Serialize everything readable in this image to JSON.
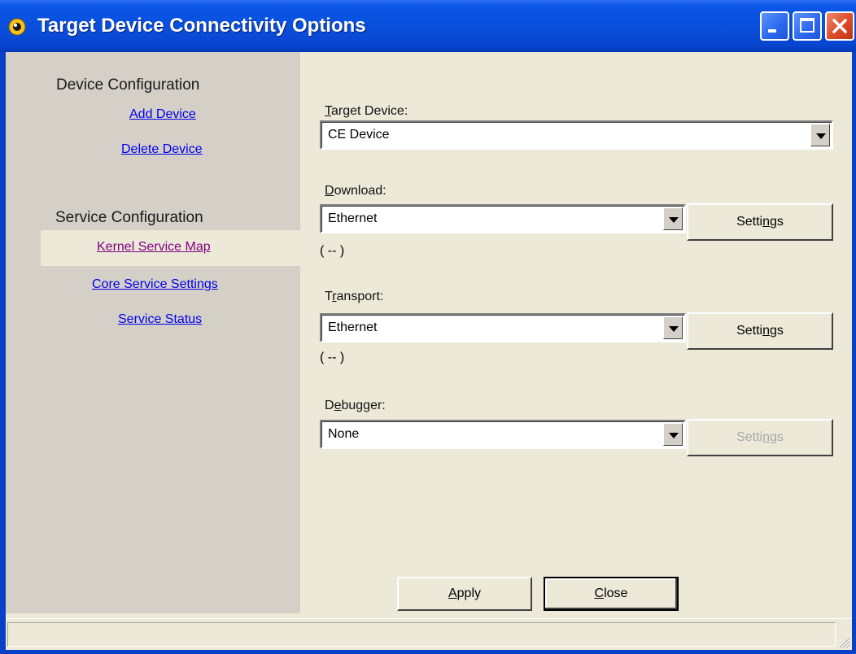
{
  "window": {
    "title": "Target Device Connectivity Options",
    "controls": [
      "minimize-icon",
      "maximize-icon",
      "close-icon"
    ]
  },
  "sidebar": {
    "device_configuration": {
      "heading": "Device Configuration",
      "links": [
        "Add Device",
        "Delete Device"
      ]
    },
    "service_configuration": {
      "heading": "Service Configuration",
      "links": [
        "Kernel Service Map",
        "Core Service Settings",
        "Service Status"
      ],
      "selected": "Kernel Service Map"
    }
  },
  "form": {
    "target_device": {
      "label_mnemonic": "T",
      "label_rest": "arget Device:",
      "value": "CE Device"
    },
    "download": {
      "label_mnemonic": "D",
      "label_rest": "ownload:",
      "value": "Ethernet",
      "status": "( -- )",
      "button_pre": "Setti",
      "button_mnemonic": "n",
      "button_post": "gs"
    },
    "transport": {
      "label_pre": "T",
      "label_mnemonic": "r",
      "label_rest": "ansport:",
      "value": "Ethernet",
      "status": "( -- )",
      "button_pre": "Setti",
      "button_mnemonic": "n",
      "button_post": "gs"
    },
    "debugger": {
      "label_pre": "D",
      "label_mnemonic": "e",
      "label_rest": "bugger:",
      "value": "None",
      "button_pre": "Setti",
      "button_mnemonic": "n",
      "button_post": "gs",
      "button_disabled": true
    }
  },
  "footer": {
    "apply_mnemonic": "A",
    "apply_rest": "pply",
    "close_mnemonic": "C",
    "close_rest": "lose"
  },
  "colors": {
    "titlebar": "#0a4fdc",
    "close_button": "#dc4a27",
    "link": "#0000ee",
    "visited_link": "#800080",
    "dialog_bg": "#ece9d8",
    "sidebar_bg": "#d4d0c8"
  }
}
